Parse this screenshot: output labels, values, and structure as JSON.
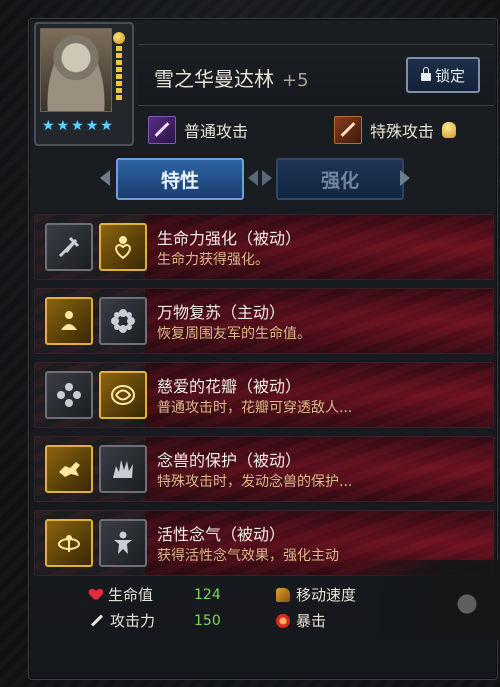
{
  "character": {
    "name": "雪之华曼达林",
    "enhance": "+5",
    "stars": [
      "★",
      "★",
      "★",
      "★",
      "★"
    ],
    "lock_label": "锁定"
  },
  "attacks": {
    "normal_label": "普通攻击",
    "special_label": "特殊攻击"
  },
  "tabs": [
    {
      "label": "特性",
      "active": true
    },
    {
      "label": "强化",
      "active": false
    }
  ],
  "skills": [
    {
      "title": "生命力强化（被动）",
      "desc": "生命力获得强化。",
      "icon_a": "sword-broken-icon",
      "icon_b": "heart-figure-icon",
      "gold": "b"
    },
    {
      "title": "万物复苏（主动）",
      "desc": "恢复周围友军的生命值。",
      "icon_a": "meditate-icon",
      "icon_b": "flower-icon",
      "gold": "a"
    },
    {
      "title": "慈爱的花瓣（被动）",
      "desc": "普通攻击时，花瓣可穿透敌人...",
      "icon_a": "flower-icon",
      "icon_b": "pattern-icon",
      "gold": "b"
    },
    {
      "title": "念兽的保护（被动）",
      "desc": "特殊攻击时，发动念兽的保护...",
      "icon_a": "beast-icon",
      "icon_b": "spiky-beast-icon",
      "gold": "a"
    },
    {
      "title": "活性念气（被动）",
      "desc": "获得活性念气效果，强化主动",
      "icon_a": "swirl-icon",
      "icon_b": "figure-icon",
      "gold": "a"
    }
  ],
  "stats": {
    "hp_label": "生命值",
    "hp_value": "124",
    "atk_label": "攻击力",
    "atk_value": "150",
    "move_label": "移动速度",
    "crit_label": "暴击"
  }
}
